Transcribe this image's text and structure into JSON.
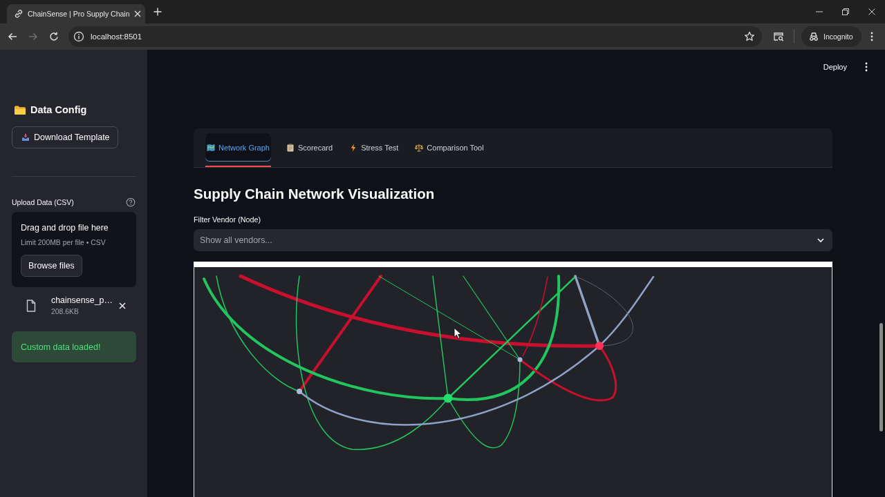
{
  "browser": {
    "tabs": [
      {
        "title": "ChainSense | Pro Supply Chain",
        "selected": true
      }
    ],
    "url": "localhost:8501",
    "forward_disabled": true,
    "profile": "Incognito"
  },
  "header": {
    "deploy": "Deploy"
  },
  "sidebar": {
    "title": "Data Config",
    "download_button": "Download Template",
    "upload": {
      "label": "Upload Data (CSV)",
      "dropzone_title": "Drag and drop file here",
      "dropzone_hint": "Limit 200MB per file • CSV",
      "browse_button": "Browse files",
      "file": {
        "name": "chainsense_p…",
        "size": "208.6KB"
      }
    },
    "success_message": "Custom data loaded!"
  },
  "tabs": [
    {
      "label": "Network Graph",
      "selected": true
    },
    {
      "label": "Scorecard",
      "selected": false
    },
    {
      "label": "Stress Test",
      "selected": false
    },
    {
      "label": "Comparison Tool",
      "selected": false
    }
  ],
  "heading": "Supply Chain Network Visualization",
  "filter": {
    "label": "Filter Vendor (Node)",
    "placeholder": "Show all vendors..."
  },
  "graph": {
    "edges": [
      {
        "color": "#c8102e"
      },
      {
        "color": "#c8102e"
      },
      {
        "color": "#22c55e"
      },
      {
        "color": "#22c55e"
      },
      {
        "color": "#22c55e"
      },
      {
        "color": "#22c55e"
      },
      {
        "color": "#22c55e"
      },
      {
        "color": "#22c55e"
      },
      {
        "color": "#22c55e"
      },
      {
        "color": "#22c55e"
      },
      {
        "color": "#c8102e"
      },
      {
        "color": "#c8102e"
      },
      {
        "color": "#8ea2c8"
      },
      {
        "color": "#8ea2c8"
      },
      {
        "color": "#5b6070"
      }
    ],
    "nodes": [
      {
        "color": "#a9b9d8"
      },
      {
        "color": "#22dd66"
      },
      {
        "color": "#a9b9d8"
      },
      {
        "color": "#ff3355"
      }
    ]
  }
}
